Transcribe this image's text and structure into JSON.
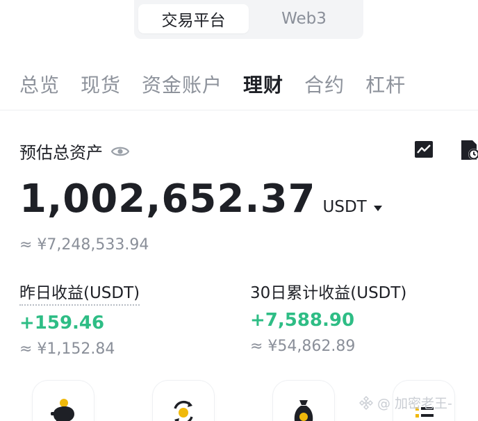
{
  "top_switch": {
    "platform": "交易平台",
    "web3": "Web3"
  },
  "tabs": [
    {
      "label": "总览"
    },
    {
      "label": "现货"
    },
    {
      "label": "资金账户"
    },
    {
      "label": "理财"
    },
    {
      "label": "合约"
    },
    {
      "label": "杠杆"
    }
  ],
  "active_tab": "理财",
  "assets": {
    "label": "预估总资产",
    "amount": "1,002,652.37",
    "unit": "USDT",
    "cny": "≈ ¥7,248,533.94"
  },
  "yesterday": {
    "title": "昨日收益(USDT)",
    "value": "+159.46",
    "cny": "≈ ¥1,152.84"
  },
  "thirty_day": {
    "title": "30日累计收益(USDT)",
    "value": "+7,588.90",
    "cny": "≈ ¥54,862.89"
  },
  "quick_actions": [
    {
      "icon": "piggy-bank-icon"
    },
    {
      "icon": "auto-invest-icon"
    },
    {
      "icon": "money-bag-icon"
    },
    {
      "icon": "list-icon"
    }
  ],
  "watermark": {
    "text": "@ 加密老王-"
  },
  "colors": {
    "positive": "#2ebd85",
    "accent": "#f0b90b",
    "muted": "#8a8f99"
  }
}
